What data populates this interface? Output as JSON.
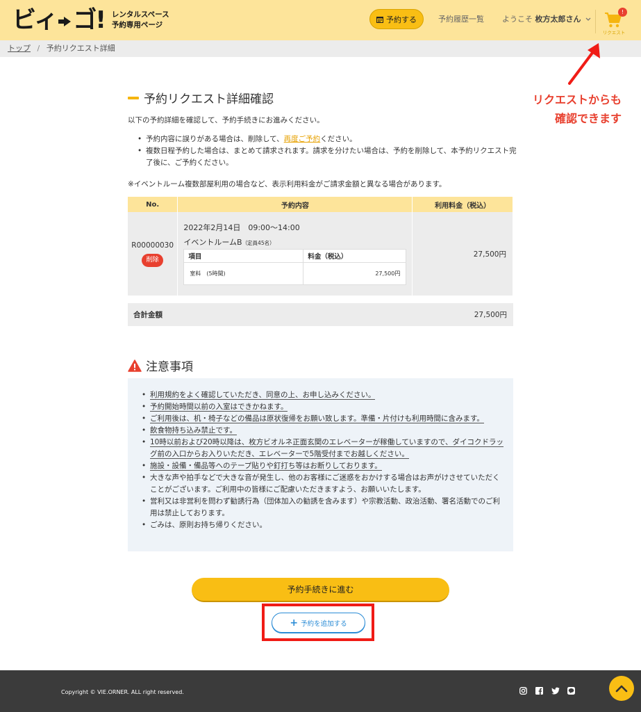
{
  "header": {
    "logo_main_left": "ビィ",
    "logo_main_right": "ゴ!",
    "logo_sub_line1": "レンタルスペース",
    "logo_sub_line2": "予約専用ページ",
    "reserve_button": "予約する",
    "history_link": "予約履歴一覧",
    "welcome_prefix": "ようこそ",
    "user_name": "枚方太郎さん",
    "cart_badge": "!",
    "cart_label": "リクエスト"
  },
  "breadcrumb": {
    "home": "トップ",
    "separator": "/",
    "current": "予約リクエスト詳細"
  },
  "annotation": {
    "line1": "リクエストからも",
    "line2": "確認できます"
  },
  "main": {
    "title": "予約リクエスト詳細確認",
    "intro": "以下の予約詳細を確認して、予約手続きにお進みください。",
    "bullet1_before": "予約内容に誤りがある場合は、削除して、",
    "bullet1_link": "再度ご予約",
    "bullet1_after": "ください。",
    "bullet2": "複数日程予約した場合は、まとめて請求されます。請求を分けたい場合は、予約を削除して、本予約リクエスト完了後に、ご予約ください。",
    "note": "※イベントルーム複数部屋利用の場合など、表示利用料金がご請求金額と異なる場合があります。"
  },
  "table": {
    "headers": [
      "No.",
      "予約内容",
      "利用料金（税込）"
    ],
    "row": {
      "no": "R00000030",
      "delete_label": "削除",
      "date": "2022年2月14日　09:00〜14:00",
      "room": "イベントルームB",
      "capacity": "（定員45名）",
      "inner_headers": [
        "項目",
        "料金（税込）"
      ],
      "inner_item": "室料　(5時間)",
      "inner_price": "27,500円",
      "price": "27,500円"
    },
    "total_label": "合計金額",
    "total_value": "27,500円"
  },
  "caution": {
    "title": "注意事項",
    "items": [
      "利用規約をよく確認していただき、同意の上、お申し込みください。",
      "予約開始時間以前の入室はできかねます。",
      "ご利用後は、机・椅子などの備品は原状復帰をお願い致します。準備・片付けも利用時間に含みます。",
      "飲食物持ち込み禁止です。",
      "10時以前および20時以降は、枚方ビオルネ正面玄関のエレベーターが稼働していますので、ダイコクドラッグ前の入口からお入りいただき、エレベーターで5階受付までお越しください。",
      "施設・設備・備品等へのテープ貼りや釘打ち等はお断りしております。",
      "大きな声や拍手などで大きな音が発生し、他のお客様にご迷惑をおかけする場合はお声がけさせていただくことがございます。ご利用中の皆様にご配慮いただきますよう、お願いいたします。",
      "営利又は非営利を問わず勧誘行為（団体加入の勧誘を含みます）や宗教活動、政治活動、署名活動でのご利用は禁止しております。",
      "ごみは、原則お持ち帰りください。"
    ]
  },
  "actions": {
    "proceed": "予約手続きに進む",
    "add": "予約を追加する"
  },
  "footer": {
    "copyright": "Copyright © VIE.ORNER. ALL right reserved."
  },
  "colors": {
    "header_bg": "#fde49a",
    "accent_yellow": "#f9be14",
    "alert_red": "#e8402f",
    "link_blue": "#2b8cd6"
  }
}
